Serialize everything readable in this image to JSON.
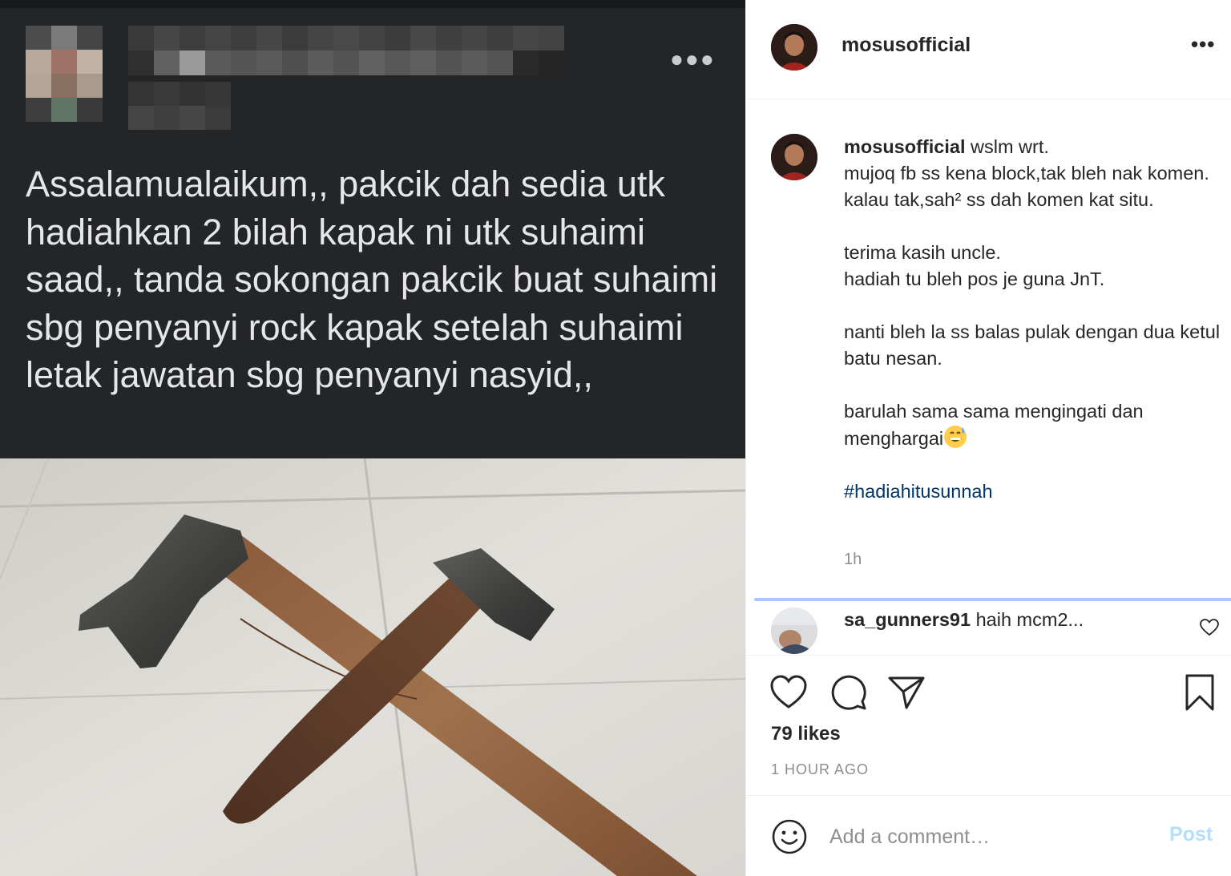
{
  "post_image": {
    "more_icon": "ellipsis-icon",
    "fb_text": "Assalamualaikum,, pakcik dah sedia utk hadiahkan 2 bilah kapak ni utk suhaimi saad,, tanda sokongan pakcik buat suhaimi sbg penyanyi rock kapak setelah suhaimi letak jawatan sbg penyanyi nasyid,,"
  },
  "header": {
    "username": "mosusofficial",
    "more_icon": "ellipsis-icon"
  },
  "caption": {
    "username": "mosusofficial",
    "lines": [
      "wslm wrt.",
      "mujoq fb ss kena block,tak bleh nak komen.",
      "kalau tak,sah² ss dah komen kat situ.",
      "",
      "terima kasih uncle.",
      "hadiah tu bleh pos je guna JnT.",
      "",
      "nanti bleh la ss balas pulak dengan dua ketul batu nesan.",
      "",
      "barulah sama sama mengingati dan menghargai"
    ],
    "emoji": "grinning-sweat-emoji",
    "hashtag": "#hadiahitusunnah",
    "time": "1h"
  },
  "comments": [
    {
      "username": "sa_gunners91",
      "text": "haih mcm2..."
    }
  ],
  "actions": {
    "like_icon": "heart-icon",
    "comment_icon": "comment-bubble-icon",
    "share_icon": "paper-plane-icon",
    "save_icon": "bookmark-icon"
  },
  "likes": "79 likes",
  "posted_time": "1 HOUR AGO",
  "add_comment": {
    "placeholder": "Add a comment…",
    "post_label": "Post",
    "emoji_icon": "smiley-icon"
  },
  "colors": {
    "hashtag": "#00376b",
    "muted": "#8e8e8e",
    "post_button_disabled": "#b2dffc",
    "fb_dark_bg": "#242526"
  }
}
